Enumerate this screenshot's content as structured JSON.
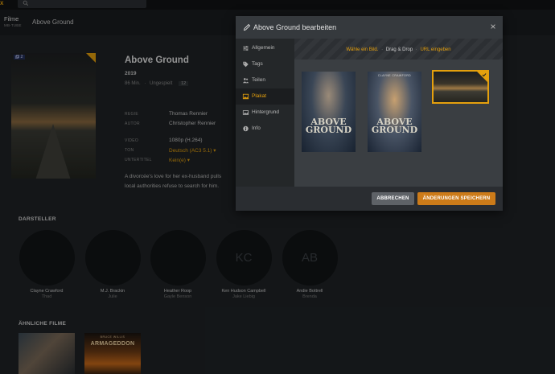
{
  "topbar": {
    "search_placeholder": ""
  },
  "header": {
    "library_name": "Filme",
    "library_sub": "MB-TUBE",
    "breadcrumb": "Above Ground"
  },
  "movie": {
    "title": "Above Ground",
    "year": "2019",
    "duration": "86 Min.",
    "separator": "·",
    "status": "Ungespielt",
    "rating": "12",
    "version_badge": "2",
    "details": [
      {
        "label": "REGIE",
        "value": "Thomas Rennier"
      },
      {
        "label": "AUTOR",
        "value": "Christopher Rennier"
      },
      {
        "label": "VIDEO",
        "value": "1080p (H.264)"
      },
      {
        "label": "TON",
        "value": "Deutsch (AC3 5.1) ▾"
      },
      {
        "label": "UNTERTITEL",
        "value": "Kein(e) ▾"
      }
    ],
    "summary_line1": "A divorcée's love for her ex-husband pulls",
    "summary_line2": "local authorities refuse to search for him."
  },
  "cast_section": "DARSTELLER",
  "cast": [
    {
      "initials": "",
      "name": "Clayne Crawford",
      "role": "Thad"
    },
    {
      "initials": "",
      "name": "M.J. Brackin",
      "role": "Julie"
    },
    {
      "initials": "",
      "name": "Heather Roop",
      "role": "Gayle Benson"
    },
    {
      "initials": "KC",
      "name": "Ken Hudson Campbell",
      "role": "Jake Liebig"
    },
    {
      "initials": "AB",
      "name": "Andie Bottrell",
      "role": "Brenda"
    }
  ],
  "similar_section": "ÄHNLICHE FILME",
  "similar": [
    {
      "title": ""
    },
    {
      "title": "ARMAGEDDON",
      "tagline": "BRUCE WILLIS"
    }
  ],
  "modal": {
    "title": "Above Ground bearbeiten",
    "sidebar": [
      "Allgemein",
      "Tags",
      "Teilen",
      "Plakat",
      "Hintergrund",
      "Info"
    ],
    "active_index": 3,
    "drop": {
      "choose": "Wähle ein Bild.",
      "dot": "·",
      "dragdrop": "Drag & Drop",
      "url": "URL eingeben"
    },
    "posters": [
      {
        "text": "ABOVE GROUND"
      },
      {
        "text": "ABOVE GROUND",
        "tagline": "CLAYNE CRAWFORD"
      }
    ],
    "cancel_label": "ABBRECHEN",
    "save_label": "ÄNDERUNGEN SPEICHERN"
  },
  "colors": {
    "accent": "#e5a00d",
    "save_button": "#cc7b19",
    "cancel_button": "#5e6267",
    "background": "#1f2326"
  },
  "icons": [
    "search-icon",
    "pencil-icon",
    "close-icon",
    "sliders-icon",
    "tags-icon",
    "users-icon",
    "image-icon",
    "background-icon",
    "info-icon",
    "versions-icon",
    "checkmark-icon"
  ]
}
